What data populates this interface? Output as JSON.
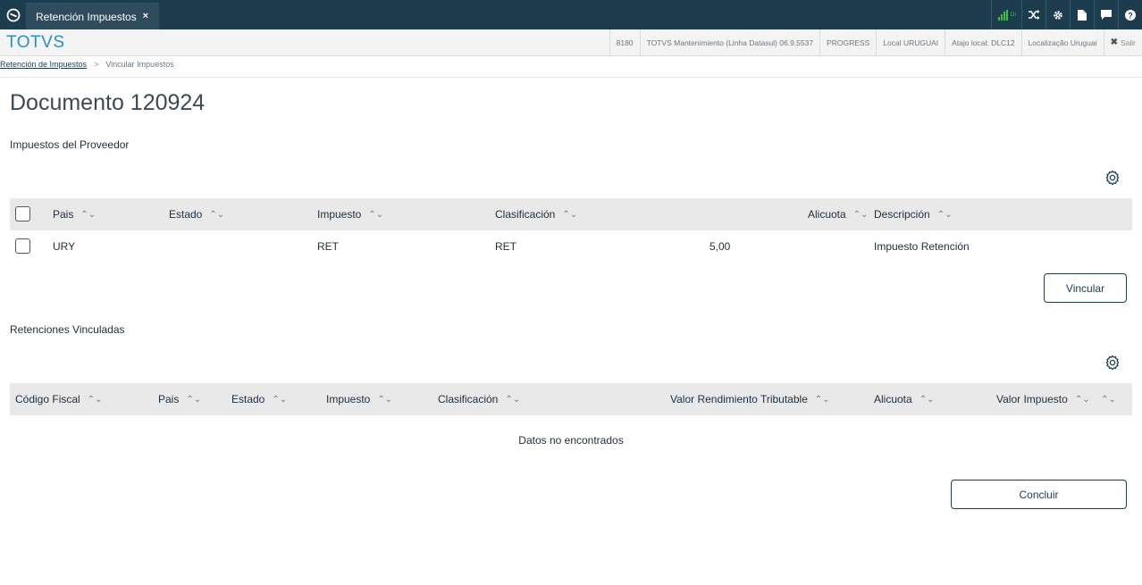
{
  "topbar": {
    "tab_label": "Retención Impuestos",
    "tab_close": "×",
    "icons": [
      "signal-icon",
      "shuffle-icon",
      "gear-icon",
      "document-icon",
      "chat-icon",
      "help-icon"
    ],
    "signal_text": "DI",
    "accent": "#1d3d4f",
    "signal_color": "#3fbf3f"
  },
  "appbar": {
    "brand": "TOTVS",
    "info": [
      "8180",
      "TOTVS Mantenimiento (Linha Datasul) 06.9.5537",
      "PROGRESS",
      "Local URUGUAI",
      "Atajo local: DLC12",
      "Localização Uruguai"
    ],
    "logout": "Salir"
  },
  "breadcrumb": {
    "link": "Retención de Impuestos",
    "separator": ">",
    "current": "Vincular Impuestos"
  },
  "page_title": "Documento 120924",
  "supplier_taxes": {
    "title": "Impuestos del Proveedor",
    "columns": [
      "Pais",
      "Estado",
      "Impuesto",
      "Clasificación",
      "Alicuota",
      "Descripción"
    ],
    "rows": [
      {
        "pais": "URY",
        "estado": "",
        "impuesto": "RET",
        "clasificacion": "RET",
        "alicuota": "5,00",
        "descripcion": "Impuesto Retención"
      }
    ],
    "action": "Vincular"
  },
  "linked_retentions": {
    "title": "Retenciones Vinculadas",
    "columns": [
      "Código Fiscal",
      "Pais",
      "Estado",
      "Impuesto",
      "Clasificación",
      "Valor Rendimiento Tributable",
      "Alicuota",
      "Valor Impuesto"
    ],
    "empty_message": "Datos no encontrados"
  },
  "footer": {
    "conclude": "Concluir"
  }
}
